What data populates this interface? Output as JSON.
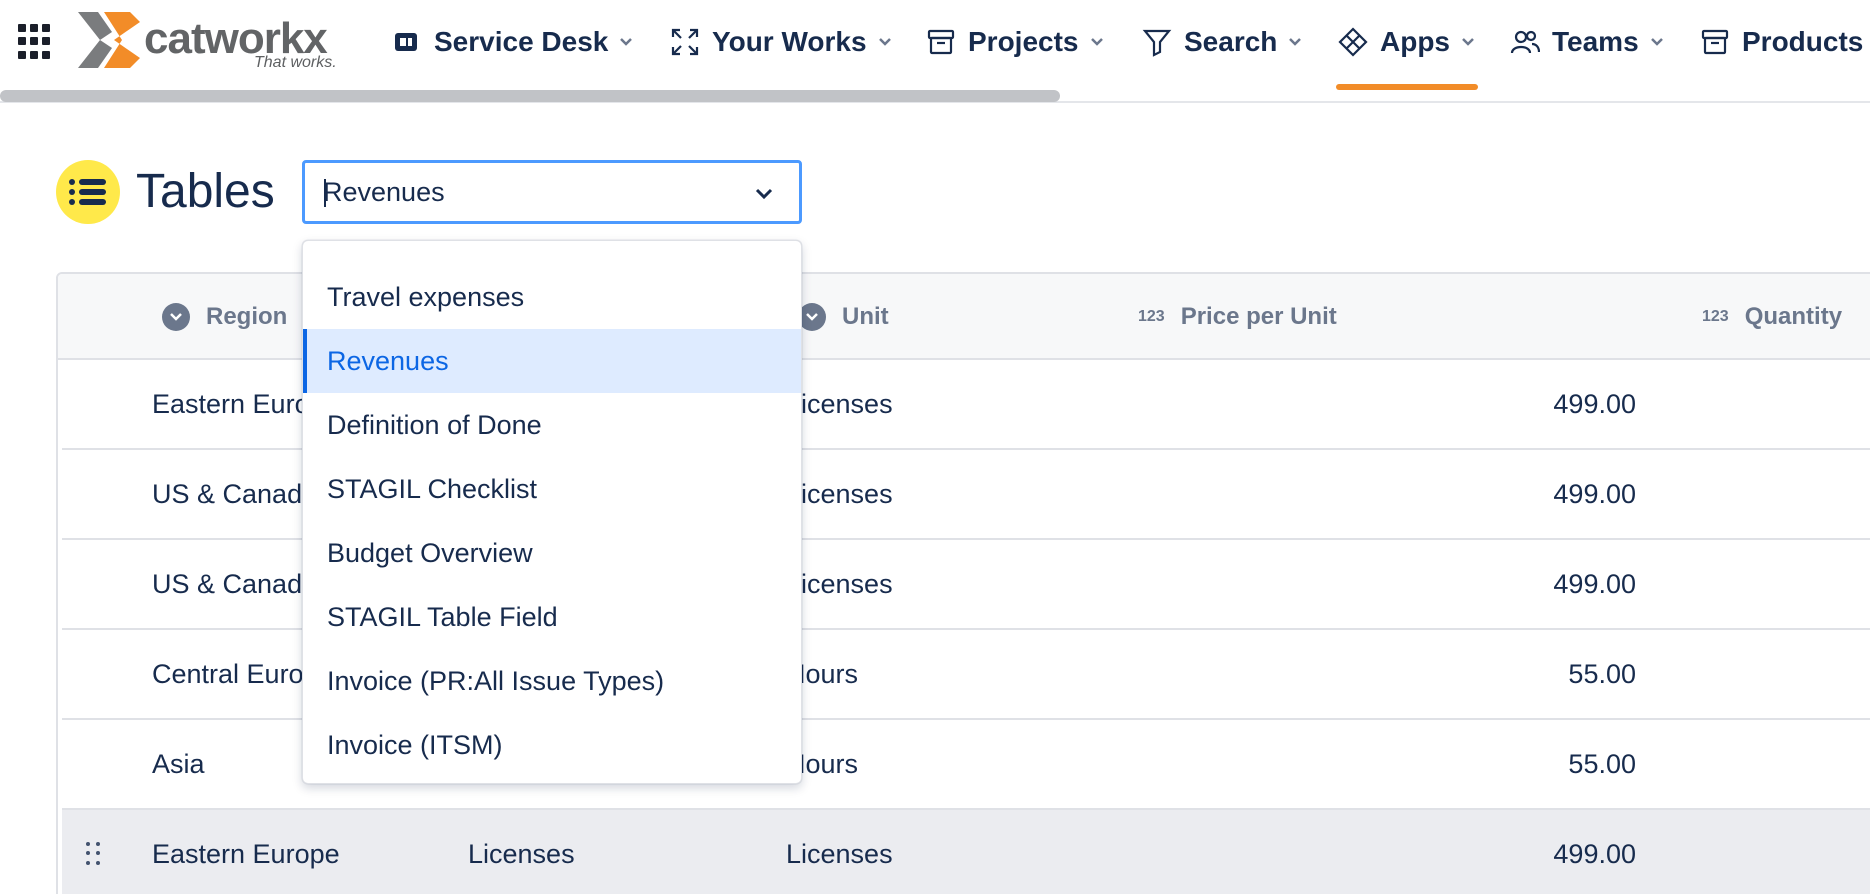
{
  "nav": {
    "brand_word": "catworkx",
    "brand_tagline": "That works.",
    "items": [
      {
        "label": "Service Desk",
        "icon": "service-desk-icon"
      },
      {
        "label": "Your Works",
        "icon": "expand-arrows-icon"
      },
      {
        "label": "Projects",
        "icon": "archive-box-icon"
      },
      {
        "label": "Search",
        "icon": "filter-funnel-icon"
      },
      {
        "label": "Apps",
        "icon": "apps-diamond-icon",
        "active": true
      },
      {
        "label": "Teams",
        "icon": "people-icon"
      },
      {
        "label": "Products",
        "icon": "archive-box-icon"
      }
    ],
    "accent_color": "#f28c28"
  },
  "page": {
    "title": "Tables",
    "icon": "list-icon",
    "icon_bg": "#ffe94a"
  },
  "table_select": {
    "value": "Revenues",
    "options": [
      "Travel expenses",
      "Revenues",
      "Definition of Done",
      "STAGIL Checklist",
      "Budget Overview",
      "STAGIL Table Field",
      "Invoice (PR:All Issue Types)",
      "Invoice (ITSM)"
    ],
    "selected_index": 1
  },
  "table": {
    "columns": [
      {
        "label": "Region",
        "icon": "dropdown-circle-icon"
      },
      {
        "label": "Unit",
        "icon": "dropdown-circle-icon"
      },
      {
        "label": "Price per Unit",
        "icon": "number-type-icon",
        "icon_text": "123"
      },
      {
        "label": "Quantity",
        "icon": "number-type-icon",
        "icon_text": "123"
      }
    ],
    "rows": [
      {
        "region": "Eastern Europe",
        "product": "",
        "unit": "Licenses",
        "price": "499.00"
      },
      {
        "region": "US & Canada",
        "product": "",
        "unit": "Licenses",
        "price": "499.00"
      },
      {
        "region": "US & Canada",
        "product": "",
        "unit": "Licenses",
        "price": "499.00"
      },
      {
        "region": "Central Europe",
        "product": "",
        "unit": "Hours",
        "price": "55.00"
      },
      {
        "region": "Asia",
        "product": "",
        "unit": "Hours",
        "price": "55.00"
      },
      {
        "region": "Eastern Europe",
        "product": "Licenses",
        "unit": "Licenses",
        "price": "499.00",
        "hovered": true
      }
    ]
  }
}
